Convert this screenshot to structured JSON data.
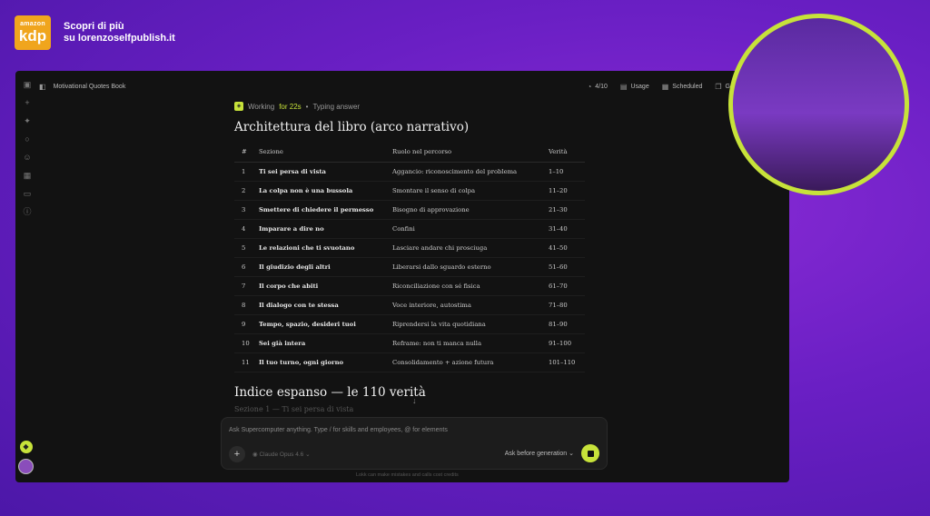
{
  "brand": {
    "logo_top": "amazon",
    "logo_main": "kdp",
    "promo_line1": "Scopri di più",
    "promo_line2": "su lorenzoselfpublish.it"
  },
  "topbar": {
    "title": "Motivational Quotes Book",
    "progress": "4/10",
    "usage": "Usage",
    "scheduled": "Scheduled",
    "gallery": "Gall"
  },
  "status": {
    "label": "Working",
    "for": "for 22s",
    "sep": "•",
    "typing": "Typing answer"
  },
  "heading1": "Architettura del libro (arco narrativo)",
  "table": {
    "headers": [
      "#",
      "Sezione",
      "Ruolo nel percorso",
      "Verità"
    ],
    "rows": [
      [
        "1",
        "Ti sei persa di vista",
        "Aggancio: riconoscimento del problema",
        "1–10"
      ],
      [
        "2",
        "La colpa non è una bussola",
        "Smontare il senso di colpa",
        "11–20"
      ],
      [
        "3",
        "Smettere di chiedere il permesso",
        "Bisogno di approvazione",
        "21–30"
      ],
      [
        "4",
        "Imparare a dire no",
        "Confini",
        "31–40"
      ],
      [
        "5",
        "Le relazioni che ti svuotano",
        "Lasciare andare chi prosciuga",
        "41–50"
      ],
      [
        "6",
        "Il giudizio degli altri",
        "Liberarsi dallo sguardo esterno",
        "51–60"
      ],
      [
        "7",
        "Il corpo che abiti",
        "Riconciliazione con sé fisica",
        "61–70"
      ],
      [
        "8",
        "Il dialogo con te stessa",
        "Voce interiore, autostima",
        "71–80"
      ],
      [
        "9",
        "Tempo, spazio, desideri tuoi",
        "Riprendersi la vita quotidiana",
        "81–90"
      ],
      [
        "10",
        "Sei già intera",
        "Reframe: non ti manca nulla",
        "91–100"
      ],
      [
        "11",
        "Il tuo turno, ogni giorno",
        "Consolidamento + azione futura",
        "101–110"
      ]
    ]
  },
  "heading2": "Indice espanso — le 110 verità",
  "faded_line": "Sezione 1 — Ti sei persa di vista",
  "composer": {
    "placeholder": "Ask Supercomputer anything. Type / for skills and employees, @ for elements",
    "model": "Claude Opus 4.6",
    "mode": "Ask before generation"
  },
  "footer_note": "Lokk can make mistakes and calls cost credits",
  "icons": [
    "sidebar-toggle-icon",
    "new-icon",
    "compass-icon",
    "search-icon",
    "people-icon",
    "calendar-icon",
    "folder-icon",
    "info-icon",
    "clock-icon",
    "usage-icon",
    "scheduled-icon",
    "gallery-icon",
    "gem-icon",
    "model-icon",
    "stop-icon",
    "scroll-down-icon"
  ],
  "colors": {
    "accent": "#c7e23a",
    "app_bg": "#121212",
    "page_bg": "#6a1fc4",
    "kdp": "#f0a51d"
  }
}
